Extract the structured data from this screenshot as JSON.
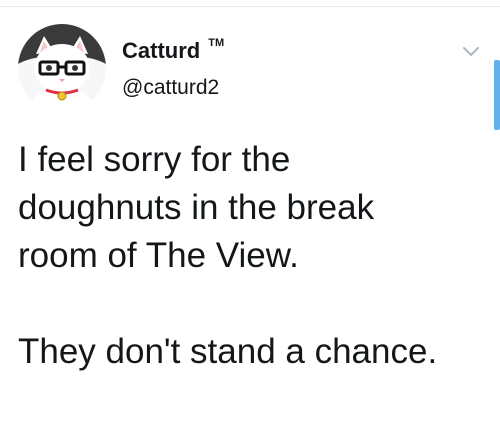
{
  "tweet": {
    "display_name": "Catturd",
    "tm_mark": "TM",
    "handle": "@catturd2",
    "text": "I feel sorry for the doughnuts in the break room of The View.\n\nThey don't stand a chance."
  },
  "icons": {
    "avatar": "cat-with-glasses-avatar",
    "menu": "chevron-down-icon"
  },
  "colors": {
    "text": "#14171a",
    "divider": "#e6ecf0",
    "scrollbar": "#62b1ec",
    "caret": "#aab8c2"
  }
}
